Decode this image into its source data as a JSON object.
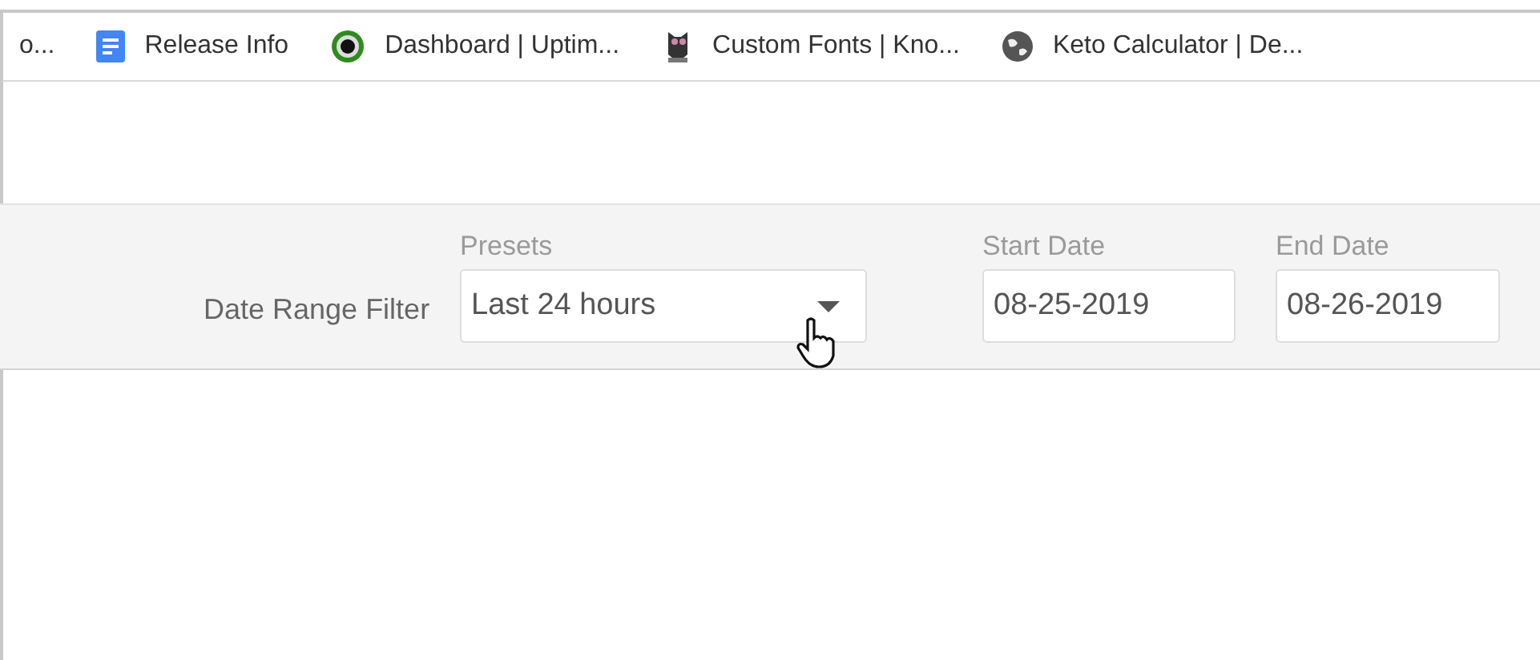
{
  "bookmarks": [
    {
      "label": "o...",
      "kind": "none"
    },
    {
      "label": "Release Info",
      "kind": "doc"
    },
    {
      "label": "Dashboard | Uptim...",
      "kind": "ring"
    },
    {
      "label": "Custom Fonts | Kno...",
      "kind": "owl"
    },
    {
      "label": "Keto Calculator | De...",
      "kind": "globe"
    }
  ],
  "filter": {
    "title": "Date Range Filter",
    "presets": {
      "label": "Presets",
      "value": "Last 24 hours"
    },
    "start_date": {
      "label": "Start Date",
      "value": "08-25-2019"
    },
    "end_date": {
      "label": "End Date",
      "value": "08-26-2019"
    }
  }
}
